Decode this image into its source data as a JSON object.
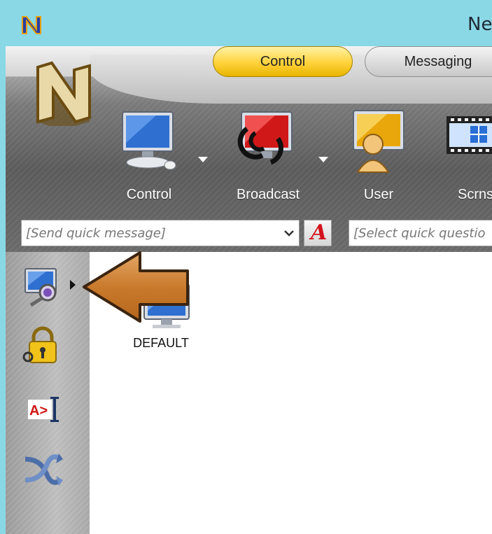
{
  "window": {
    "title": "Ne"
  },
  "ribbon": {
    "tabs": [
      {
        "label": "Control"
      },
      {
        "label": "Messaging"
      }
    ],
    "tools": [
      {
        "label": "Control",
        "icon": "monitor-icon"
      },
      {
        "label": "Broadcast",
        "icon": "broadcast-icon"
      },
      {
        "label": "User",
        "icon": "user-icon"
      },
      {
        "label": "Scrnsh",
        "icon": "screenshot-icon"
      }
    ],
    "quick_message": {
      "placeholder": "[Send quick message]"
    },
    "quick_question": {
      "placeholder": "[Select quick questio"
    },
    "font_button": {
      "glyph": "A"
    }
  },
  "sidebar": {
    "items": [
      {
        "icon": "computer-search-icon"
      },
      {
        "icon": "lock-icon"
      },
      {
        "icon": "text-input-icon",
        "glyph": "A>"
      },
      {
        "icon": "shuffle-icon"
      }
    ]
  },
  "content": {
    "computers": [
      {
        "label": "DEFAULT",
        "icon": "computer-icon"
      }
    ]
  },
  "colors": {
    "titlebar": "#8ad8e6",
    "active_tab": "#ffd23a",
    "arrow": "#c97a2c"
  }
}
